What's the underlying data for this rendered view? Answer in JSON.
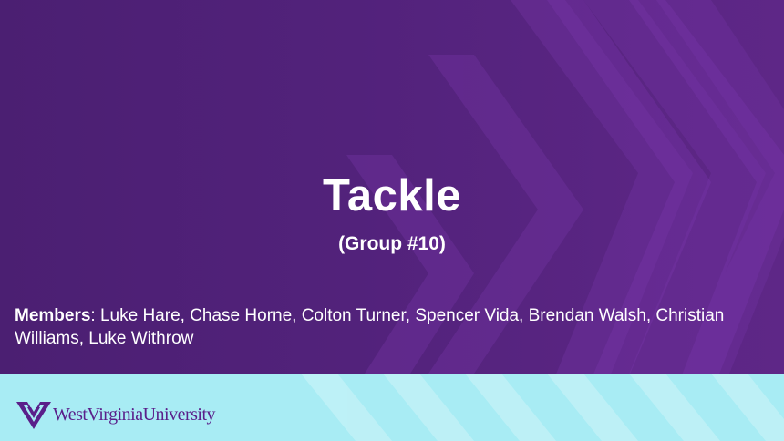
{
  "slide": {
    "title": "Tackle",
    "subtitle": "(Group #10)",
    "members_label": "Members",
    "members_list": ": Luke Hare, Chase Horne, Colton Turner, Spencer Vida, Brendan Walsh, Christian Williams, Luke Withrow"
  },
  "footer": {
    "logo_text": "WestVirginiaUniversity",
    "logo_icon": "flying-wv-icon"
  },
  "colors": {
    "background": "#52227b",
    "pattern": "#6a2d98",
    "footer": "#a8ecf4",
    "logo": "#5a1f8a",
    "text": "#ffffff"
  }
}
